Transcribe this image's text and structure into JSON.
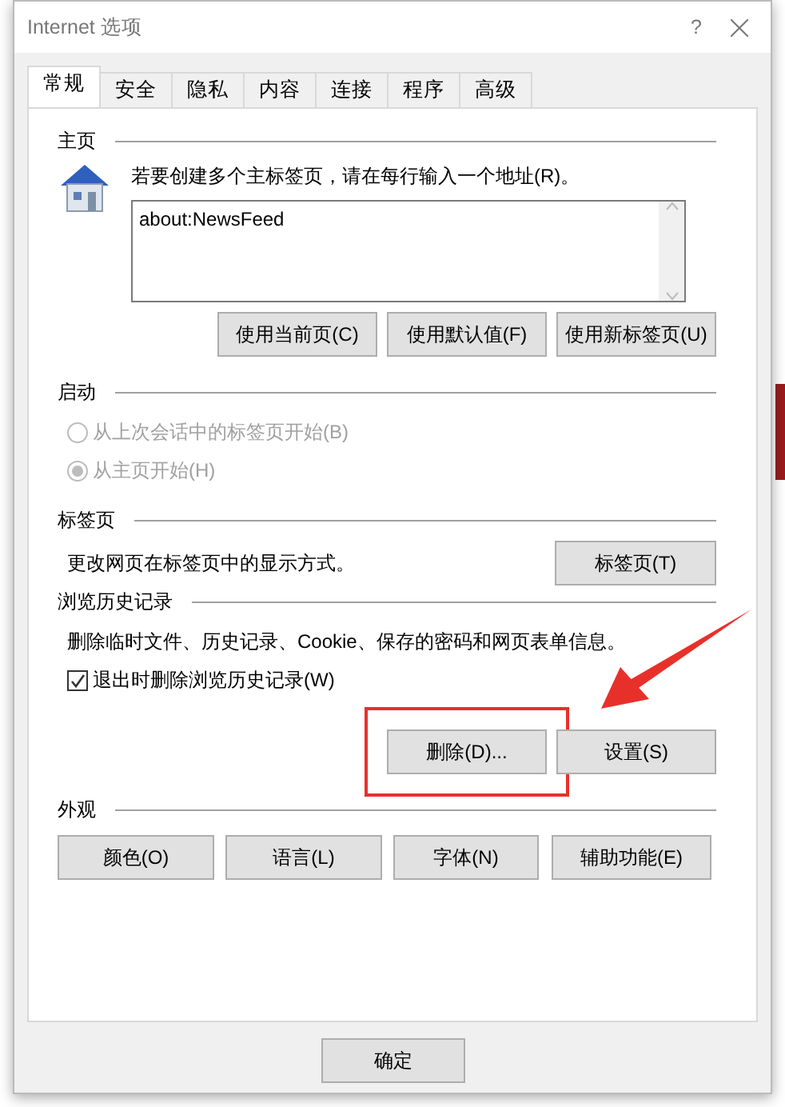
{
  "window": {
    "title": "Internet 选项",
    "help": "?"
  },
  "tabs": [
    {
      "label": "常规",
      "selected": true
    },
    {
      "label": "安全",
      "selected": false
    },
    {
      "label": "隐私",
      "selected": false
    },
    {
      "label": "内容",
      "selected": false
    },
    {
      "label": "连接",
      "selected": false
    },
    {
      "label": "程序",
      "selected": false
    },
    {
      "label": "高级",
      "selected": false
    }
  ],
  "home_page": {
    "heading": "主页",
    "hint": "若要创建多个主标签页，请在每行输入一个地址(R)。",
    "value": "about:NewsFeed",
    "buttons": [
      "使用当前页(C)",
      "使用默认值(F)",
      "使用新标签页(U)"
    ]
  },
  "startup": {
    "heading": "启动",
    "disabled": true,
    "options": [
      {
        "label": "从上次会话中的标签页开始(B)",
        "selected": false
      },
      {
        "label": "从主页开始(H)",
        "selected": true
      }
    ]
  },
  "tabs_section": {
    "heading": "标签页",
    "description": "更改网页在标签页中的显示方式。",
    "button": "标签页(T)"
  },
  "history": {
    "heading": "浏览历史记录",
    "description": "删除临时文件、历史记录、Cookie、保存的密码和网页表单信息。",
    "checkbox": {
      "label": "退出时删除浏览历史记录(W)",
      "checked": true
    },
    "buttons": [
      {
        "label": "删除(D)...",
        "highlighted": true
      },
      {
        "label": "设置(S)",
        "highlighted": false
      }
    ]
  },
  "appearance": {
    "heading": "外观",
    "buttons": [
      "颜色(O)",
      "语言(L)",
      "字体(N)",
      "辅助功能(E)"
    ]
  },
  "footer_buttons": [
    "确定"
  ]
}
